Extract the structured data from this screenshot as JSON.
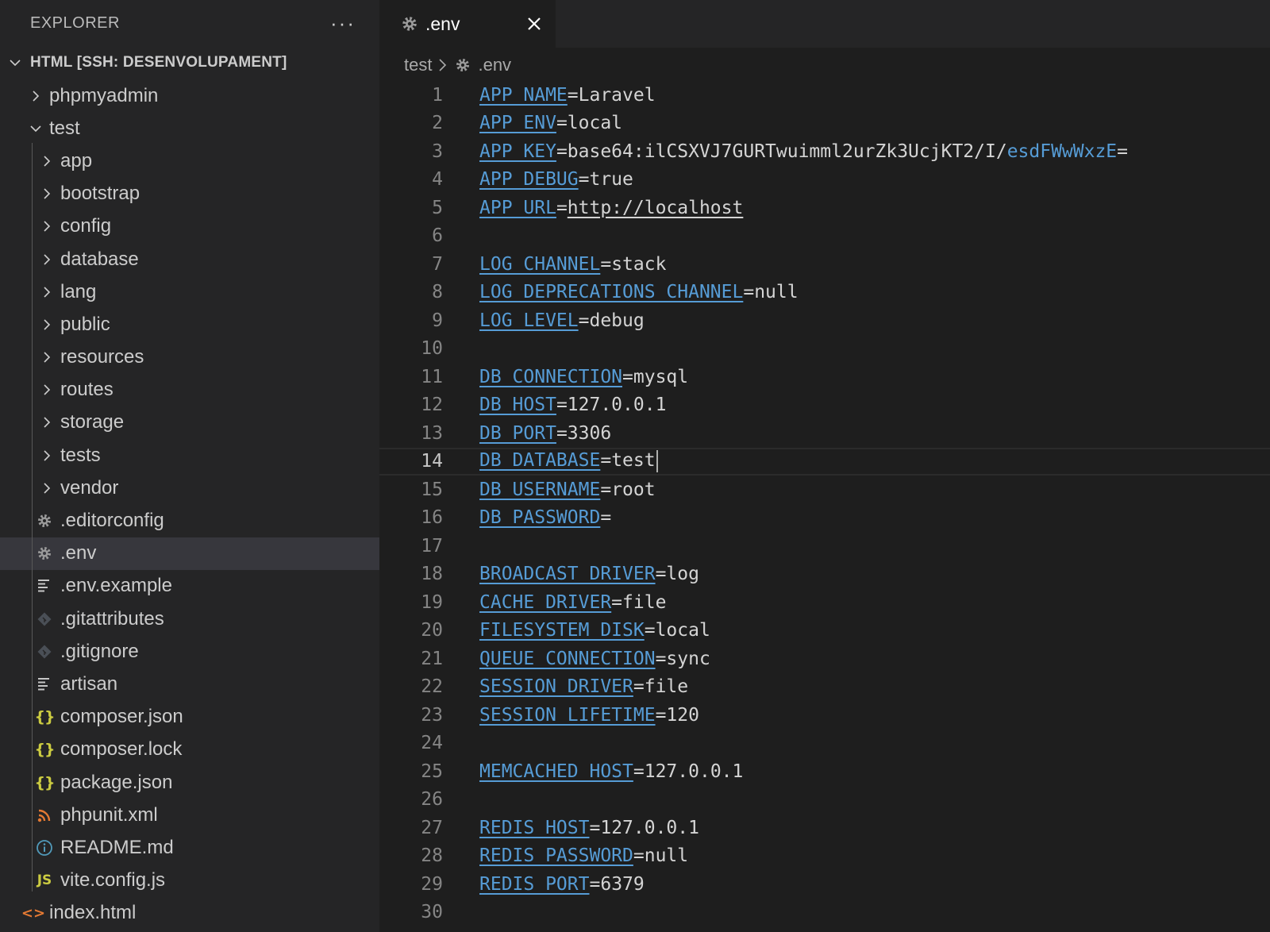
{
  "sidebar": {
    "title": "EXPLORER",
    "more_label": "···",
    "workspace_label": "HTML [SSH: DESENVOLUPAMENT]",
    "items": [
      {
        "label": "phpmyadmin",
        "type": "folder",
        "depth": 0,
        "expanded": false
      },
      {
        "label": "test",
        "type": "folder",
        "depth": 0,
        "expanded": true
      },
      {
        "label": "app",
        "type": "folder",
        "depth": 1,
        "expanded": false
      },
      {
        "label": "bootstrap",
        "type": "folder",
        "depth": 1,
        "expanded": false
      },
      {
        "label": "config",
        "type": "folder",
        "depth": 1,
        "expanded": false
      },
      {
        "label": "database",
        "type": "folder",
        "depth": 1,
        "expanded": false
      },
      {
        "label": "lang",
        "type": "folder",
        "depth": 1,
        "expanded": false
      },
      {
        "label": "public",
        "type": "folder",
        "depth": 1,
        "expanded": false
      },
      {
        "label": "resources",
        "type": "folder",
        "depth": 1,
        "expanded": false
      },
      {
        "label": "routes",
        "type": "folder",
        "depth": 1,
        "expanded": false
      },
      {
        "label": "storage",
        "type": "folder",
        "depth": 1,
        "expanded": false
      },
      {
        "label": "tests",
        "type": "folder",
        "depth": 1,
        "expanded": false
      },
      {
        "label": "vendor",
        "type": "folder",
        "depth": 1,
        "expanded": false
      },
      {
        "label": ".editorconfig",
        "type": "file",
        "icon": "gear-icon",
        "depth": 1
      },
      {
        "label": ".env",
        "type": "file",
        "icon": "gear-icon",
        "depth": 1,
        "selected": true
      },
      {
        "label": ".env.example",
        "type": "file",
        "icon": "lines-icon",
        "depth": 1
      },
      {
        "label": ".gitattributes",
        "type": "file",
        "icon": "git-icon",
        "depth": 1
      },
      {
        "label": ".gitignore",
        "type": "file",
        "icon": "git-icon",
        "depth": 1
      },
      {
        "label": "artisan",
        "type": "file",
        "icon": "lines-icon",
        "depth": 1
      },
      {
        "label": "composer.json",
        "type": "file",
        "icon": "json-icon",
        "depth": 1
      },
      {
        "label": "composer.lock",
        "type": "file",
        "icon": "json-icon",
        "depth": 1
      },
      {
        "label": "package.json",
        "type": "file",
        "icon": "json-icon",
        "depth": 1
      },
      {
        "label": "phpunit.xml",
        "type": "file",
        "icon": "rss-icon",
        "depth": 1
      },
      {
        "label": "README.md",
        "type": "file",
        "icon": "info-icon",
        "depth": 1
      },
      {
        "label": "vite.config.js",
        "type": "file",
        "icon": "js-icon",
        "depth": 1
      },
      {
        "label": "index.html",
        "type": "file",
        "icon": "html-icon",
        "depth": 0
      }
    ]
  },
  "icon_glyphs": {
    "json-icon": "{}",
    "js-icon": "JS",
    "html-icon": "<>"
  },
  "tab": {
    "label": ".env",
    "icon": "gear-icon",
    "close_icon": "close-icon"
  },
  "breadcrumb": {
    "folder": "test",
    "file": ".env"
  },
  "editor": {
    "current_line": 14,
    "lines": [
      {
        "n": 1,
        "key": "APP_NAME",
        "value": "Laravel"
      },
      {
        "n": 2,
        "key": "APP_ENV",
        "value": "local"
      },
      {
        "n": 3,
        "key": "APP_KEY",
        "value": "base64:ilCSXVJ7GURTwuimml2urZk3UcjKT2/I/",
        "value_tail": "esdFWwWxzE",
        "value_end": "="
      },
      {
        "n": 4,
        "key": "APP_DEBUG",
        "value": "true"
      },
      {
        "n": 5,
        "key": "APP_URL",
        "value": "http://localhost",
        "link": true
      },
      {
        "n": 6
      },
      {
        "n": 7,
        "key": "LOG_CHANNEL",
        "value": "stack"
      },
      {
        "n": 8,
        "key": "LOG_DEPRECATIONS_CHANNEL",
        "value": "null"
      },
      {
        "n": 9,
        "key": "LOG_LEVEL",
        "value": "debug"
      },
      {
        "n": 10
      },
      {
        "n": 11,
        "key": "DB_CONNECTION",
        "value": "mysql"
      },
      {
        "n": 12,
        "key": "DB_HOST",
        "value": "127.0.0.1"
      },
      {
        "n": 13,
        "key": "DB_PORT",
        "value": "3306"
      },
      {
        "n": 14,
        "key": "DB_DATABASE",
        "value": "test"
      },
      {
        "n": 15,
        "key": "DB_USERNAME",
        "value": "root"
      },
      {
        "n": 16,
        "key": "DB_PASSWORD",
        "value": ""
      },
      {
        "n": 17
      },
      {
        "n": 18,
        "key": "BROADCAST_DRIVER",
        "value": "log"
      },
      {
        "n": 19,
        "key": "CACHE_DRIVER",
        "value": "file"
      },
      {
        "n": 20,
        "key": "FILESYSTEM_DISK",
        "value": "local"
      },
      {
        "n": 21,
        "key": "QUEUE_CONNECTION",
        "value": "sync"
      },
      {
        "n": 22,
        "key": "SESSION_DRIVER",
        "value": "file"
      },
      {
        "n": 23,
        "key": "SESSION_LIFETIME",
        "value": "120"
      },
      {
        "n": 24
      },
      {
        "n": 25,
        "key": "MEMCACHED_HOST",
        "value": "127.0.0.1"
      },
      {
        "n": 26
      },
      {
        "n": 27,
        "key": "REDIS_HOST",
        "value": "127.0.0.1"
      },
      {
        "n": 28,
        "key": "REDIS_PASSWORD",
        "value": "null"
      },
      {
        "n": 29,
        "key": "REDIS_PORT",
        "value": "6379"
      },
      {
        "n": 30
      }
    ]
  },
  "colors": {
    "key": "#569cd6",
    "text": "#d4d4d4",
    "line_number": "#858585",
    "sidebar_bg": "#252526",
    "editor_bg": "#1e1e1e",
    "selection_bg": "#37373d"
  }
}
